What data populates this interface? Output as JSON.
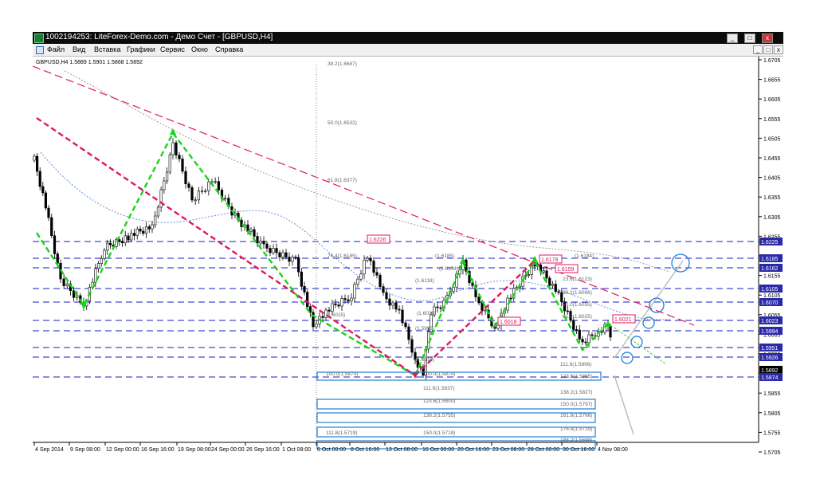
{
  "window": {
    "title": "1002194253: LiteForex-Demo.com - Демо Счет - [GBPUSD,H4]",
    "controls": [
      "_",
      "□",
      "x"
    ]
  },
  "menu": {
    "items": [
      "Файл",
      "Вид",
      "Вставка",
      "Графики",
      "Сервис",
      "Окно",
      "Справка"
    ],
    "doc_controls": [
      "_",
      "□",
      "x"
    ]
  },
  "chart": {
    "symbol_info": "GBPUSD,H4  1.5889 1.5901 1.5868 1.5892",
    "price_ticks": [
      "1.6705",
      "1.6655",
      "1.6605",
      "1.6555",
      "1.6505",
      "1.6455",
      "1.6405",
      "1.6355",
      "1.6305",
      "1.6255",
      "1.6205",
      "1.6155",
      "1.6105",
      "1.6055",
      "1.6005",
      "1.5955",
      "1.5905",
      "1.5855",
      "1.5805",
      "1.5755",
      "1.5705"
    ],
    "time_ticks": [
      "4 Sep 2014",
      "9 Sep 08:00",
      "12 Sep 00:00",
      "16 Sep 16:00",
      "19 Sep 08:00",
      "24 Sep 00:00",
      "26 Sep 16:00",
      "1 Oct 08:00",
      "6 Oct 00:00",
      "8 Oct 16:00",
      "13 Oct 08:00",
      "16 Oct 00:00",
      "20 Oct 16:00",
      "23 Oct 08:00",
      "28 Oct 00:00",
      "30 Oct 16:00",
      "4 Nov 08:00"
    ],
    "hline_labels": [
      {
        "text": "1.6225",
        "bg": "#2a2aa8"
      },
      {
        "text": "1.6185",
        "bg": "#2a2aa8"
      },
      {
        "text": "1.6162",
        "bg": "#2a2aa8"
      },
      {
        "text": "1.6105",
        "bg": "#2a2aa8"
      },
      {
        "text": "1.6070",
        "bg": "#2a2aa8"
      },
      {
        "text": "1.6023",
        "bg": "#2a2aa8"
      },
      {
        "text": "1.5994",
        "bg": "#2a2aa8"
      },
      {
        "text": "1.5951",
        "bg": "#2a2aa8"
      },
      {
        "text": "1.5926",
        "bg": "#2a2aa8"
      },
      {
        "text": "1.5892",
        "bg": "#000000"
      },
      {
        "text": "1.5874",
        "bg": "#2a2aa8"
      }
    ],
    "highlight_labels": [
      "1.6226",
      "1.6178",
      "1.6159",
      "1.6018",
      "1.6021"
    ],
    "fib_labels": [
      "38.2(1.6687)",
      "50.0(1.6532)",
      "61.8(1.6377)",
      "76.4(1.6185)",
      "(1.6185)",
      "(1.6154)",
      "23.6(1.6123)",
      "38.2(1.6086)",
      "50.0(1.6055)",
      "61.8(1.6025)",
      "(1.6184)",
      "100.0(1.5874)",
      "100.0(1.5874)",
      "111.8(1.5896)",
      "123.6(1.5865)",
      "111.8(1.5837)",
      "138.2(1.5827)",
      "123.6(1.5800)",
      "150.0(1.5797)",
      "138.2(1.5755)",
      "161.8(1.5766)",
      "111.8(1.5719)",
      "150.0(1.5718)",
      "176.4(1.5729)",
      "188.2(1.5698)",
      "(1.5993)",
      "(1.5910)",
      "(1.6029)",
      "(1.6118)",
      "(1.6015)"
    ],
    "colors": {
      "uptrend": "#18d418",
      "downtrend": "#e0185a",
      "level": "#1b1bc0",
      "candle": "#000000",
      "fib_box": "#1a7fd6"
    }
  }
}
